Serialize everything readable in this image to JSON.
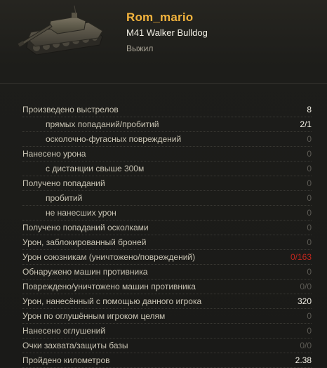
{
  "header": {
    "player_name": "Rom_mario",
    "vehicle_name": "M41 Walker Bulldog",
    "status": "Выжил",
    "tank_icon": "tank-icon"
  },
  "stats": [
    {
      "label": "Произведено выстрелов",
      "value": "8",
      "sub": false,
      "tone": "bright"
    },
    {
      "label": "прямых попаданий/пробитий",
      "value": "2/1",
      "sub": true,
      "tone": "bright"
    },
    {
      "label": "осколочно-фугасных повреждений",
      "value": "0",
      "sub": true,
      "tone": "dim"
    },
    {
      "label": "Нанесено урона",
      "value": "0",
      "sub": false,
      "tone": "dim"
    },
    {
      "label": "с дистанции свыше 300м",
      "value": "0",
      "sub": true,
      "tone": "dim"
    },
    {
      "label": "Получено попаданий",
      "value": "0",
      "sub": false,
      "tone": "dim"
    },
    {
      "label": "пробитий",
      "value": "0",
      "sub": true,
      "tone": "dim"
    },
    {
      "label": "не нанесших урон",
      "value": "0",
      "sub": true,
      "tone": "dim"
    },
    {
      "label": "Получено попаданий осколками",
      "value": "0",
      "sub": false,
      "tone": "dim"
    },
    {
      "label": "Урон, заблокированный броней",
      "value": "0",
      "sub": false,
      "tone": "dim"
    },
    {
      "label": "Урон союзникам (уничтожено/повреждений)",
      "value": "0/163",
      "sub": false,
      "tone": "red"
    },
    {
      "label": "Обнаружено машин противника",
      "value": "0",
      "sub": false,
      "tone": "dim"
    },
    {
      "label": "Повреждено/уничтожено машин противника",
      "value": "0/0",
      "sub": false,
      "tone": "dim"
    },
    {
      "label": "Урон, нанесённый с помощью данного игрока",
      "value": "320",
      "sub": false,
      "tone": "bright"
    },
    {
      "label": "Урон по оглушённым игроком целям",
      "value": "0",
      "sub": false,
      "tone": "dim"
    },
    {
      "label": "Нанесено оглушений",
      "value": "0",
      "sub": false,
      "tone": "dim"
    },
    {
      "label": "Очки захвата/защиты базы",
      "value": "0/0",
      "sub": false,
      "tone": "dim"
    },
    {
      "label": "Пройдено километров",
      "value": "2.38",
      "sub": false,
      "tone": "bright"
    }
  ],
  "colors": {
    "player_name": "#f2b33d",
    "bright_value": "#f3f0e6",
    "dim_value": "#5d5b55",
    "negative_value": "#c2261e"
  }
}
